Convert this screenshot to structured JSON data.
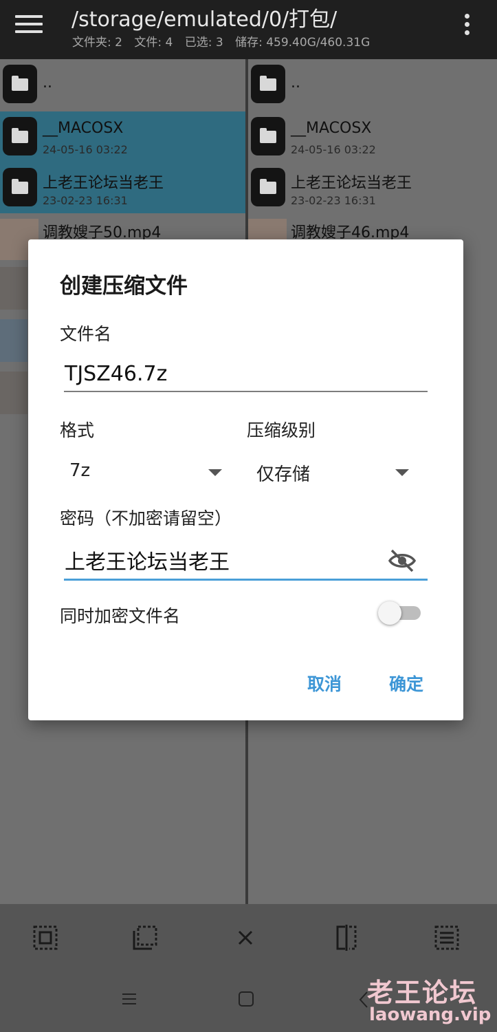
{
  "appbar": {
    "path": "/storage/emulated/0/打包/",
    "info": {
      "folders": "文件夹: 2",
      "files": "文件: 4",
      "selected": "已选: 3",
      "storage": "储存: 459.40G/460.31G"
    }
  },
  "left_pane": {
    "parent": "..",
    "items": [
      {
        "name": "__MACOSX",
        "date": "24-05-16 03:22"
      },
      {
        "name": "上老王论坛当老王",
        "date": "23-02-23 16:31"
      },
      {
        "name": "调教嫂子50.mp4"
      }
    ]
  },
  "right_pane": {
    "parent": "..",
    "items": [
      {
        "name": "__MACOSX",
        "date": "24-05-16 03:22"
      },
      {
        "name": "上老王论坛当老王",
        "date": "23-02-23 16:31"
      },
      {
        "name": "调教嫂子46.mp4"
      }
    ]
  },
  "dialog": {
    "title": "创建压缩文件",
    "filename_label": "文件名",
    "filename_value": "TJSZ46.7z",
    "format_label": "格式",
    "format_value": "7z",
    "level_label": "压缩级别",
    "level_value": "仅存储",
    "password_label": "密码（不加密请留空）",
    "password_value": "上老王论坛当老王",
    "encrypt_names_label": "同时加密文件名",
    "encrypt_names_on": false,
    "cancel": "取消",
    "ok": "确定"
  },
  "watermark": {
    "title": "老王论坛",
    "url": "laowang.vip"
  },
  "colors": {
    "accent": "#3d96d6",
    "selection": "#2f6b80",
    "appbar": "#1f1f1f"
  }
}
